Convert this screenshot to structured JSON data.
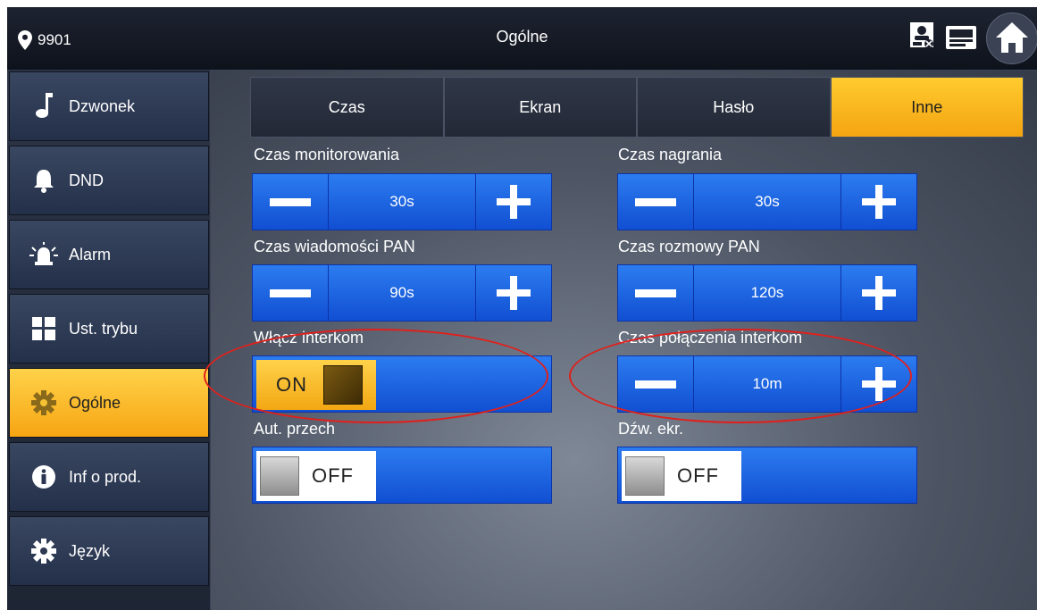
{
  "header": {
    "room_number": "9901",
    "title": "Ogólne",
    "icons": [
      "location-pin-icon",
      "contact-status-icon",
      "device-icon",
      "home-icon"
    ]
  },
  "sidebar": {
    "items": [
      {
        "label": "Dzwonek",
        "icon": "music-note-icon",
        "active": false
      },
      {
        "label": "DND",
        "icon": "bell-icon",
        "active": false
      },
      {
        "label": "Alarm",
        "icon": "alarm-siren-icon",
        "active": false
      },
      {
        "label": "Ust. trybu",
        "icon": "grid-icon",
        "active": false
      },
      {
        "label": "Ogólne",
        "icon": "gear-icon",
        "active": true
      },
      {
        "label": "Inf o prod.",
        "icon": "info-icon",
        "active": false
      },
      {
        "label": "Język",
        "icon": "gear-icon",
        "active": false
      }
    ]
  },
  "tabs": [
    {
      "label": "Czas",
      "active": false
    },
    {
      "label": "Ekran",
      "active": false
    },
    {
      "label": "Hasło",
      "active": false
    },
    {
      "label": "Inne",
      "active": true
    }
  ],
  "settings": {
    "monitoring_time": {
      "label": "Czas monitorowania",
      "value": "30s"
    },
    "record_time": {
      "label": "Czas nagrania",
      "value": "30s"
    },
    "vto_message_time": {
      "label": "Czas wiadomości PAN",
      "value": "90s"
    },
    "vto_talk_time": {
      "label": "Czas rozmowy PAN",
      "value": "120s"
    },
    "intercom_enable": {
      "label": "Włącz interkom",
      "state": "ON"
    },
    "intercom_call_time": {
      "label": "Czas połączenia interkom",
      "value": "10m"
    },
    "auto_capture": {
      "label": "Aut. przech",
      "state": "OFF"
    },
    "touch_sound": {
      "label": "Dźw. ekr.",
      "state": "OFF"
    }
  },
  "colors": {
    "accent": "#f7b21f",
    "control_blue": "#1e63e0",
    "highlight_circle": "#e0201c"
  }
}
